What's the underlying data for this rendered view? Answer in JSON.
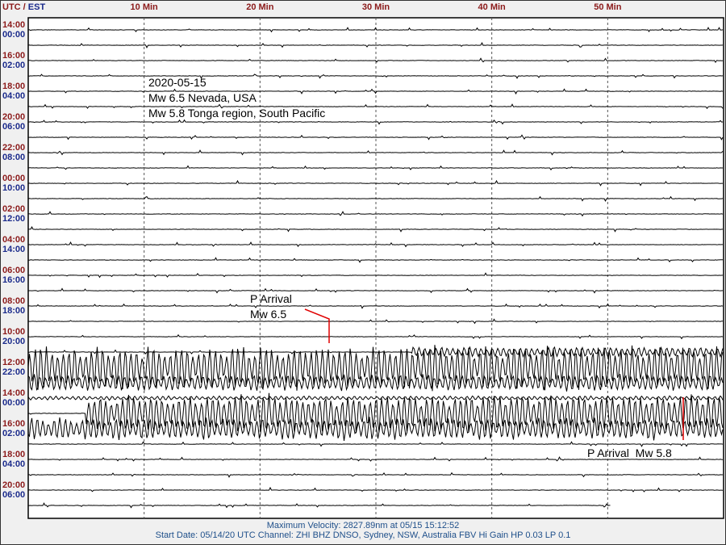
{
  "chart_data": {
    "type": "line",
    "title": "Helicorder seismogram",
    "header": {
      "utc": "UTC",
      "sep": " / ",
      "est": "EST"
    },
    "x_ticks": [
      "10 Min",
      "20 Min",
      "30 Min",
      "40 Min",
      "50 Min"
    ],
    "x_tick_values": [
      10,
      20,
      30,
      40,
      50
    ],
    "xlim": [
      0,
      60
    ],
    "lines_count": 32,
    "last_line_end_min": 50.3,
    "utc_labels": [
      "14:00",
      "16:00",
      "18:00",
      "20:00",
      "22:00",
      "00:00",
      "02:00",
      "04:00",
      "06:00",
      "08:00",
      "10:00",
      "12:00",
      "14:00",
      "16:00",
      "18:00",
      "20:00"
    ],
    "est_labels": [
      "00:00",
      "02:00",
      "04:00",
      "06:00",
      "08:00",
      "10:00",
      "12:00",
      "14:00",
      "16:00",
      "18:00",
      "20:00",
      "22:00",
      "00:00",
      "02:00",
      "04:00",
      "06:00"
    ],
    "events": [
      {
        "line": 21,
        "start_min": 33,
        "end_min": 60,
        "amplitude": 0.35
      },
      {
        "line": 22,
        "start_min": 0,
        "end_min": 60,
        "amplitude": 1.6
      },
      {
        "line": 23,
        "start_min": 0,
        "end_min": 60,
        "amplitude": 0.6
      },
      {
        "line": 24,
        "start_min": 0,
        "end_min": 60,
        "amplitude": 0.15
      },
      {
        "line": 25,
        "start_min": 5,
        "end_min": 60,
        "amplitude": 1.4
      },
      {
        "line": 26,
        "start_min": 0,
        "end_min": 60,
        "amplitude": 0.8
      }
    ],
    "grid": true
  },
  "annotations": {
    "event_lines": [
      "2020-05-15",
      "Mw 6.5 Nevada, USA",
      "Mw 5.8 Tonga region, South Pacific"
    ],
    "p1_line1": "P Arrival",
    "p1_line2": "Mw 6.5",
    "p2": "P Arrival  Mw 5.8",
    "marker_color": "#e00000"
  },
  "footer": {
    "max_velocity": "Maximum Velocity: 2827.89nm at 05/15 15:12:52",
    "start": "Start Date: 05/14/20 UTC Channel: ZHI  BHZ  DNSO, Sydney, NSW, Australia  FBV Hi Gain HP 0.03  LP 0.1"
  }
}
